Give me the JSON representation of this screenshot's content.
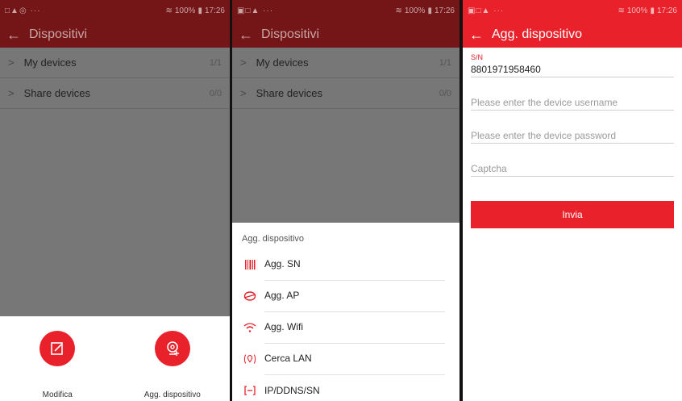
{
  "colors": {
    "accent": "#e8212b",
    "dim_accent": "#741517",
    "overlay": "#777777"
  },
  "status": {
    "s1": {
      "icons": "□▲◎ ···",
      "right": "100%",
      "time": "17:26"
    },
    "s2": {
      "icons": "▣□▲ ···",
      "right": "100%",
      "time": "17:26"
    },
    "s3": {
      "icons": "▣□▲ ···",
      "right": "100%",
      "time": "17:26"
    }
  },
  "screen1": {
    "title": "Dispositivi",
    "list": [
      {
        "label": "My devices",
        "count": "1/1"
      },
      {
        "label": "Share devices",
        "count": "0/0"
      }
    ],
    "actions": [
      {
        "label": "Modifica",
        "icon": "edit-icon"
      },
      {
        "label": "Agg. dispositivo",
        "icon": "add-camera-icon"
      }
    ]
  },
  "screen2": {
    "title": "Dispositivi",
    "list": [
      {
        "label": "My devices",
        "count": "1/1"
      },
      {
        "label": "Share devices",
        "count": "0/0"
      }
    ],
    "sheet_title": "Agg. dispositivo",
    "options": [
      {
        "label": "Agg. SN",
        "icon": "barcode-icon"
      },
      {
        "label": "Agg. AP",
        "icon": "hotspot-icon"
      },
      {
        "label": "Agg. Wifi",
        "icon": "wifi-icon"
      },
      {
        "label": "Cerca LAN",
        "icon": "lan-search-icon"
      },
      {
        "label": "IP/DDNS/SN",
        "icon": "ip-icon"
      }
    ]
  },
  "screen3": {
    "title": "Agg. dispositivo",
    "sn_label": "S/N",
    "sn_value": "8801971958460",
    "username_placeholder": "Please enter the device username",
    "password_placeholder": "Please enter the device password",
    "captcha_placeholder": "Captcha",
    "submit_label": "Invia"
  }
}
